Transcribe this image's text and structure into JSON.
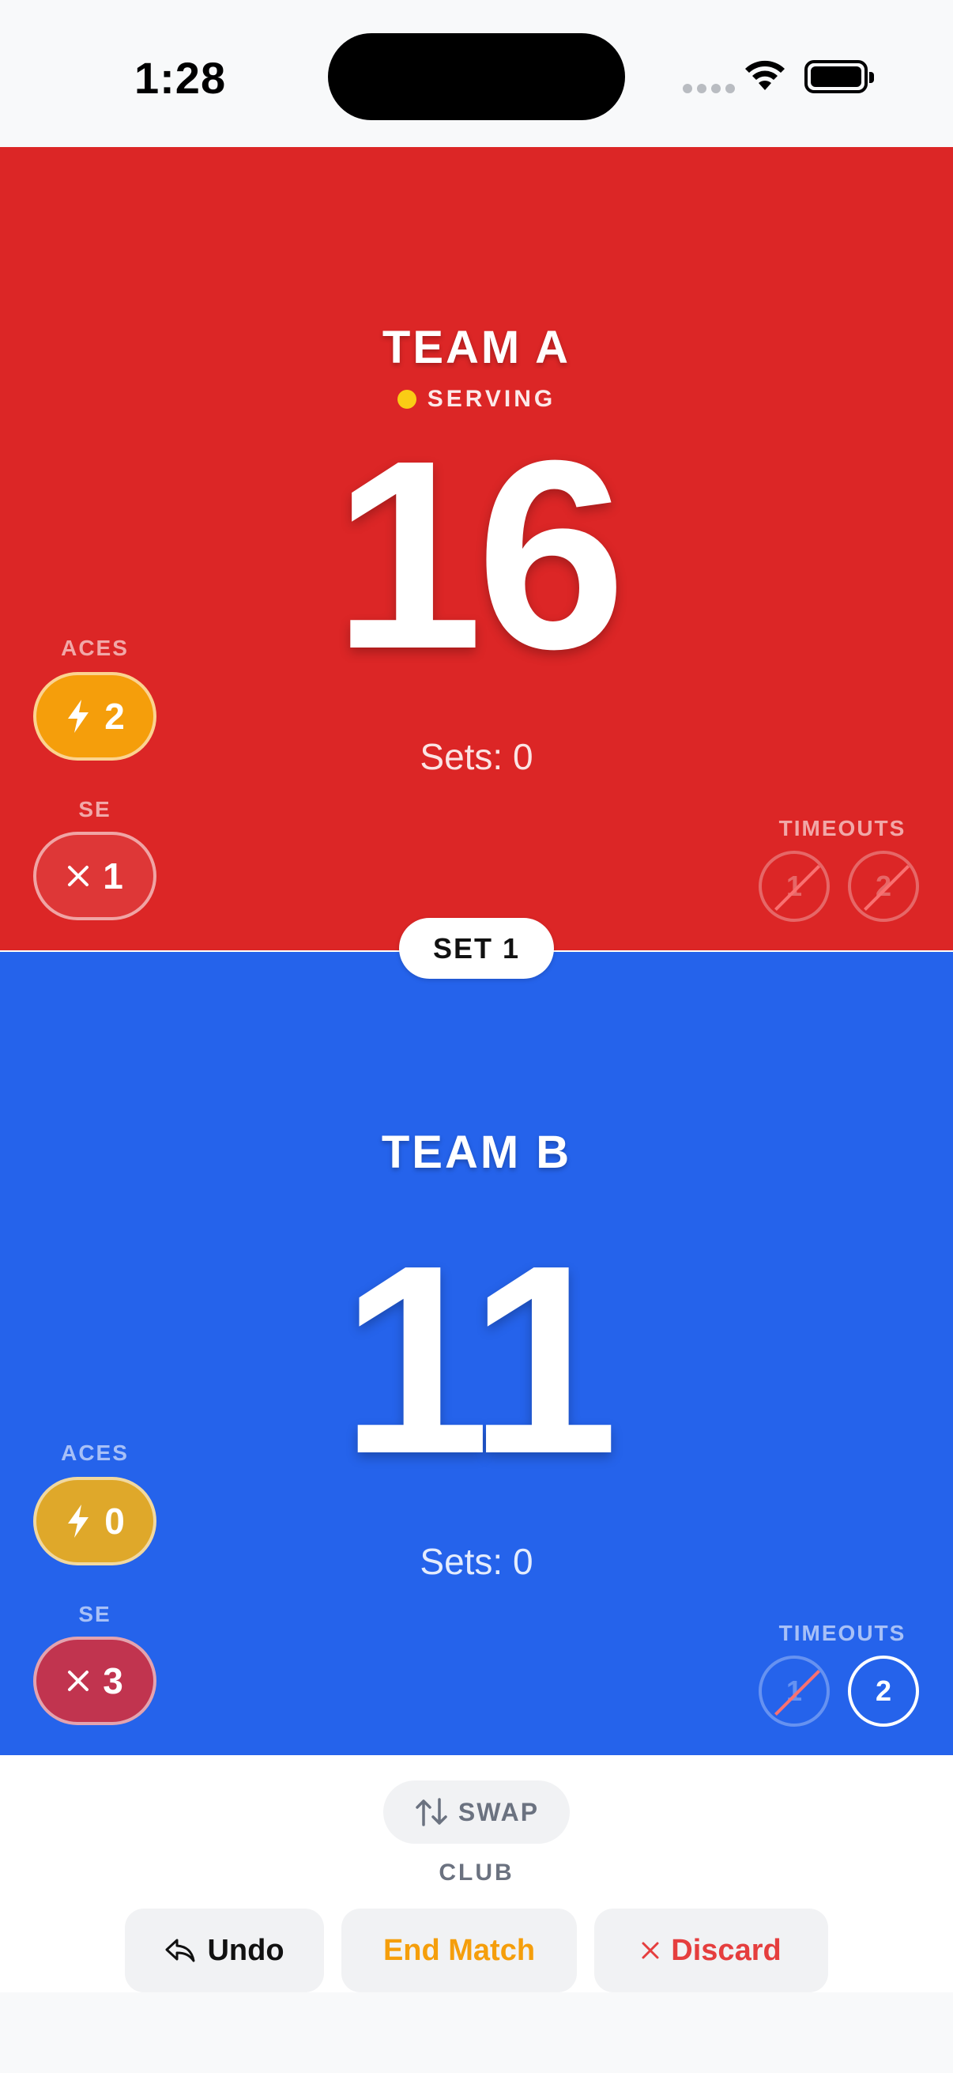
{
  "status_bar": {
    "time": "1:28"
  },
  "set_badge": "SET 1",
  "team_a": {
    "name": "TEAM A",
    "serving_label": "SERVING",
    "score": "16",
    "sets": "Sets: 0",
    "aces_label": "ACES",
    "aces": "2",
    "se_label": "SE",
    "se": "1",
    "timeouts_label": "TIMEOUTS",
    "timeouts": [
      {
        "label": "1",
        "used": true
      },
      {
        "label": "2",
        "used": true
      }
    ],
    "color": "#dc2626"
  },
  "team_b": {
    "name": "TEAM B",
    "score": "11",
    "sets": "Sets: 0",
    "aces_label": "ACES",
    "aces": "0",
    "se_label": "SE",
    "se": "3",
    "timeouts_label": "TIMEOUTS",
    "timeouts": [
      {
        "label": "1",
        "used": true
      },
      {
        "label": "2",
        "used": false
      }
    ],
    "color": "#2563eb"
  },
  "controls": {
    "swap_label": "SWAP",
    "club_label": "CLUB",
    "undo_label": "Undo",
    "end_match_label": "End Match",
    "discard_label": "Discard"
  },
  "colors": {
    "serving_dot": "#facc15",
    "aces": "#f59e0b",
    "end_match": "#f59e0b",
    "discard": "#e53e3e"
  }
}
